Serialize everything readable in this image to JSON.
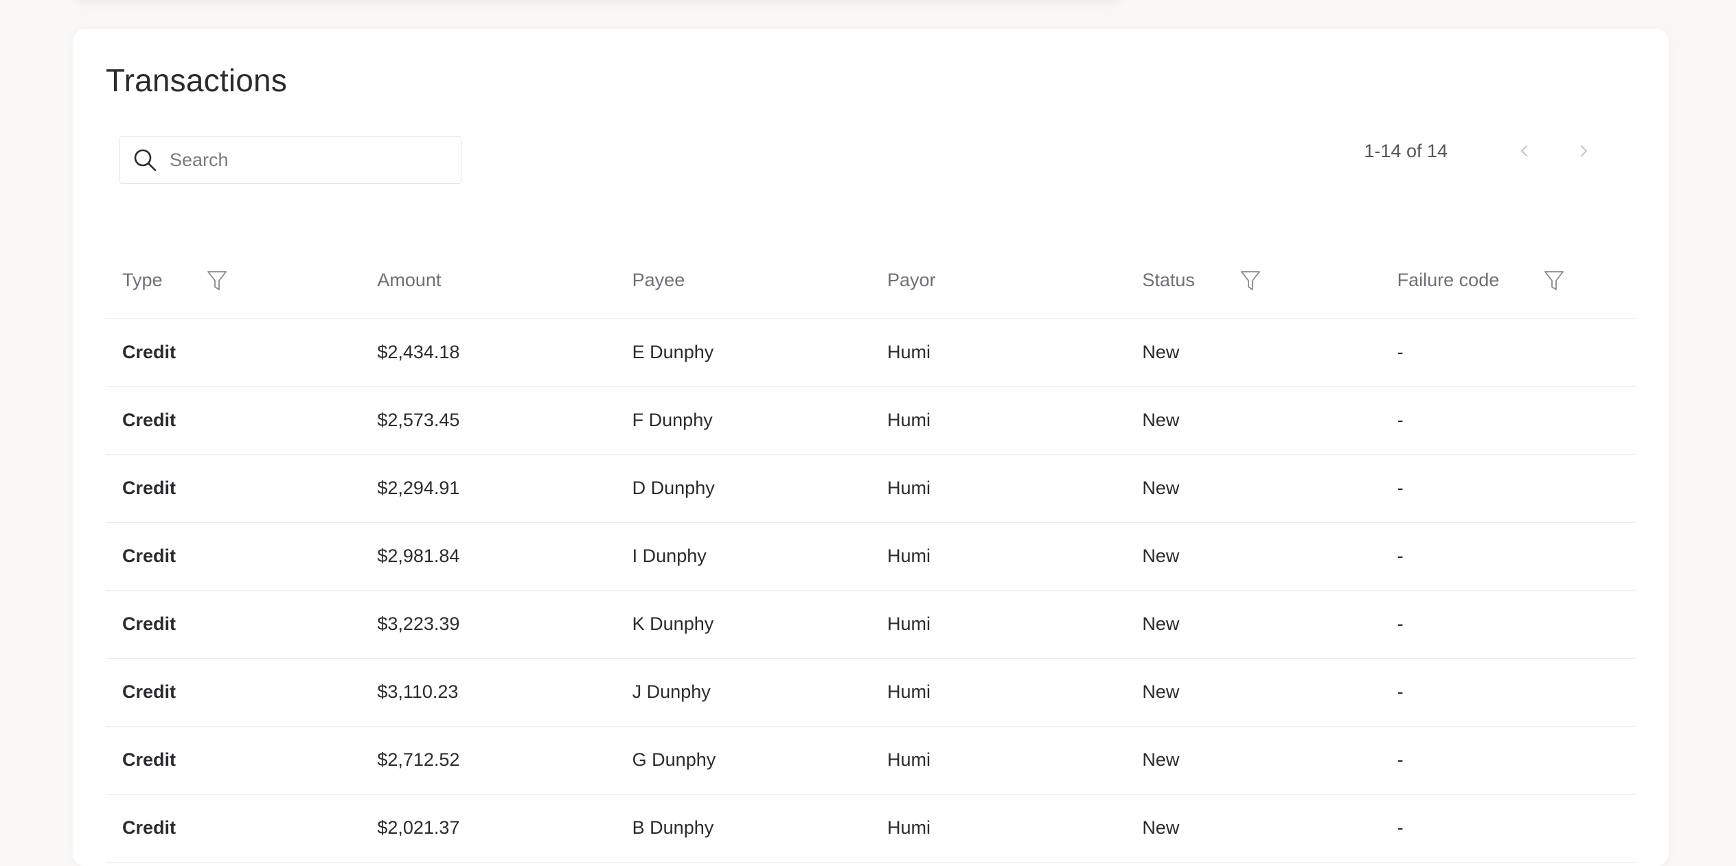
{
  "page": {
    "title": "Transactions"
  },
  "search": {
    "placeholder": "Search",
    "value": ""
  },
  "pagination": {
    "range_text": "1-14 of 14"
  },
  "table": {
    "columns": [
      {
        "label": "Type",
        "filterable": true
      },
      {
        "label": "Amount",
        "filterable": false
      },
      {
        "label": "Payee",
        "filterable": false
      },
      {
        "label": "Payor",
        "filterable": false
      },
      {
        "label": "Status",
        "filterable": true
      },
      {
        "label": "Failure code",
        "filterable": true
      }
    ],
    "rows": [
      {
        "type": "Credit",
        "amount": "$2,434.18",
        "payee": "E Dunphy",
        "payor": "Humi",
        "status": "New",
        "failure_code": "-"
      },
      {
        "type": "Credit",
        "amount": "$2,573.45",
        "payee": "F Dunphy",
        "payor": "Humi",
        "status": "New",
        "failure_code": "-"
      },
      {
        "type": "Credit",
        "amount": "$2,294.91",
        "payee": "D Dunphy",
        "payor": "Humi",
        "status": "New",
        "failure_code": "-"
      },
      {
        "type": "Credit",
        "amount": "$2,981.84",
        "payee": "I Dunphy",
        "payor": "Humi",
        "status": "New",
        "failure_code": "-"
      },
      {
        "type": "Credit",
        "amount": "$3,223.39",
        "payee": "K Dunphy",
        "payor": "Humi",
        "status": "New",
        "failure_code": "-"
      },
      {
        "type": "Credit",
        "amount": "$3,110.23",
        "payee": "J Dunphy",
        "payor": "Humi",
        "status": "New",
        "failure_code": "-"
      },
      {
        "type": "Credit",
        "amount": "$2,712.52",
        "payee": "G Dunphy",
        "payor": "Humi",
        "status": "New",
        "failure_code": "-"
      },
      {
        "type": "Credit",
        "amount": "$2,021.37",
        "payee": "B Dunphy",
        "payor": "Humi",
        "status": "New",
        "failure_code": "-"
      }
    ]
  },
  "icons": {
    "search": "search-icon",
    "filter": "filter-icon",
    "prev": "chevron-left-icon",
    "next": "chevron-right-icon"
  },
  "colors": {
    "page_background": "#f9f8f7",
    "card_background": "#ffffff",
    "text": "#2b2b2f",
    "muted_text": "#6f6f76",
    "divider": "#ececee"
  }
}
